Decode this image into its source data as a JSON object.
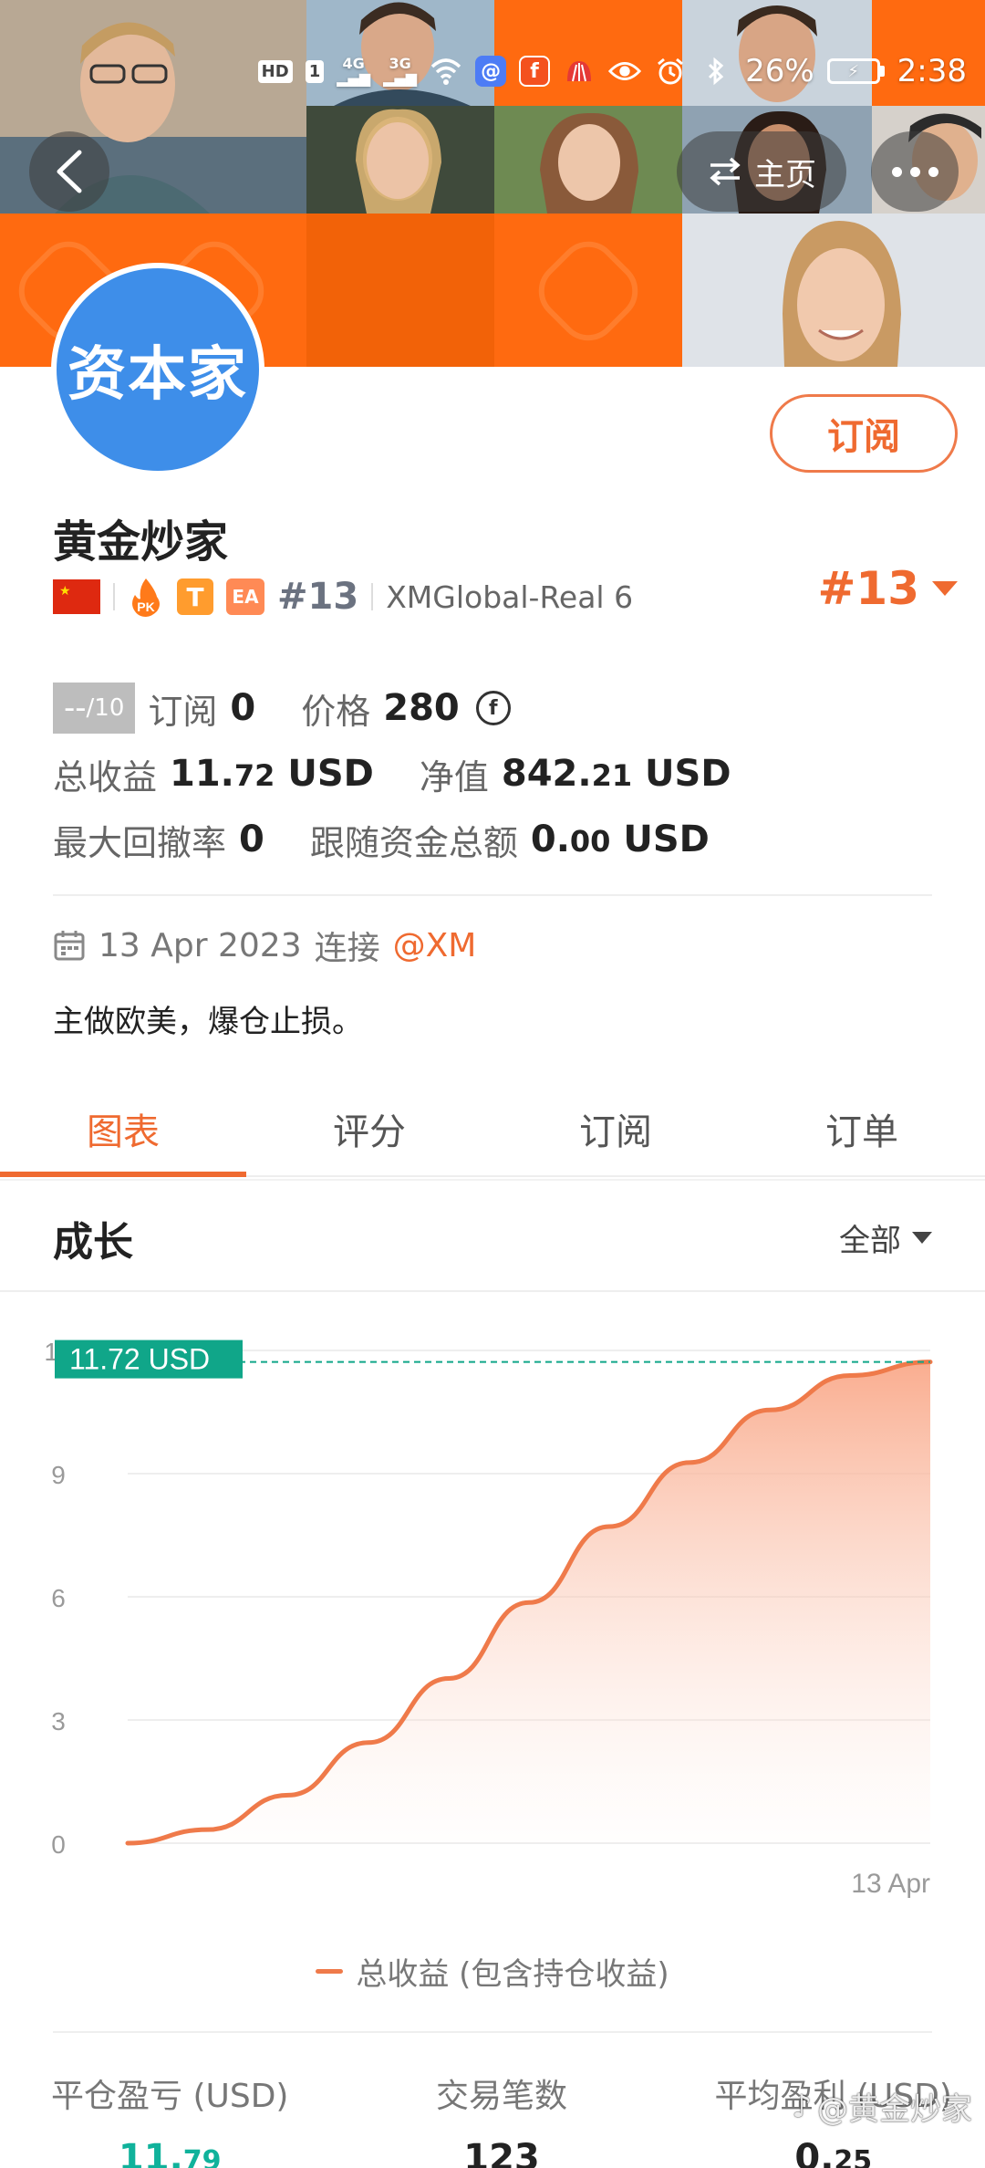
{
  "status_bar": {
    "hd": "HD",
    "sim": "1",
    "net1": "4G",
    "net2": "3G",
    "app_f": "f",
    "battery": "26%",
    "time": "2:38"
  },
  "header": {
    "home_label": "主页",
    "subscribe_label": "订阅"
  },
  "profile": {
    "avatar_text": "资本家",
    "name": "黄金炒家",
    "badge_t": "T",
    "badge_ea": "EA",
    "badge_pk": "PK",
    "rank": "#13",
    "server": "XMGlobal-Real 6",
    "rank_right": "#13"
  },
  "stats": {
    "score_dash": "--",
    "score_total": "/10",
    "subs_label": "订阅",
    "subs_value": "0",
    "price_label": "价格",
    "price_value": "280",
    "coin_symbol": "f",
    "profit_label": "总收益",
    "profit_int": "11.",
    "profit_dec": "72",
    "profit_unit": "USD",
    "equity_label": "净值",
    "equity_int": "842.",
    "equity_dec": "21",
    "equity_unit": "USD",
    "drawdown_label": "最大回撤率",
    "drawdown_value": "0",
    "follow_label": "跟随资金总额",
    "follow_int": "0.",
    "follow_dec": "00",
    "follow_unit": "USD"
  },
  "meta": {
    "date": "13 Apr 2023",
    "connect": "连接",
    "broker": "@XM",
    "description": "主做欧美，爆仓止损。"
  },
  "tabs": [
    {
      "label": "图表",
      "active": true
    },
    {
      "label": "评分",
      "active": false
    },
    {
      "label": "订阅",
      "active": false
    },
    {
      "label": "订单",
      "active": false
    }
  ],
  "section": {
    "title": "成长",
    "range": "全部"
  },
  "chart_data": {
    "type": "area",
    "title": "",
    "series": [
      {
        "name": "总收益 (包含持仓收益)",
        "color": "#ef7a4a",
        "x": [
          0,
          0.1,
          0.2,
          0.3,
          0.4,
          0.5,
          0.6,
          0.7,
          0.8,
          0.9,
          1.0
        ],
        "values": [
          0,
          0.33,
          1.17,
          2.45,
          4.01,
          5.86,
          7.71,
          9.27,
          10.55,
          11.39,
          11.72
        ]
      }
    ],
    "x_tick_labels": [
      "13 Apr"
    ],
    "y_ticks": [
      0,
      3,
      6,
      9,
      12
    ],
    "ylim": [
      0,
      12
    ],
    "grid": true,
    "current_value_label": "11.72 USD",
    "legend_position": "bottom"
  },
  "bottom_stats": [
    {
      "label": "平仓盈亏 (USD)",
      "int": "11.",
      "dec": "79",
      "green": true
    },
    {
      "label": "交易笔数",
      "int": "123",
      "dec": "",
      "green": false
    },
    {
      "label": "平均盈利 (USD)",
      "int": "0.",
      "dec": "25",
      "green": false
    }
  ],
  "watermark": "@黄金炒家",
  "colors": {
    "accent": "#ef6a30",
    "banner_orange": "#ff6a10",
    "avatar_blue": "#3e8ee9",
    "label_green": "#10a689"
  }
}
